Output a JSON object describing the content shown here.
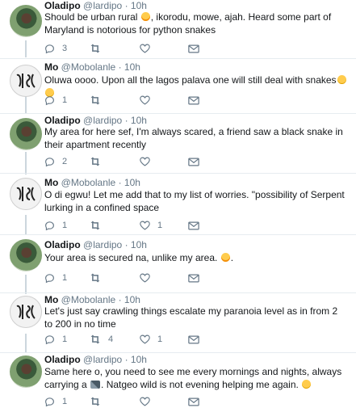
{
  "tweets": [
    {
      "author": "Oladipo",
      "handle": "@lardipo",
      "time": "10h",
      "avatar": "oladipo",
      "text_before": "Should be urban rural ",
      "emoji": "laugh",
      "text_after": ", ikorodu, mowe, ajah. Heard some part of Maryland is notorious for python snakes",
      "reply_count": "3",
      "retweet_count": "",
      "like_count": ""
    },
    {
      "author": "Mo",
      "handle": "@Mobolanle",
      "time": "10h",
      "avatar": "mo",
      "text_before": "Oluwa oooo. Upon all the lagos palava one will still deal with snakes",
      "emoji": "shock",
      "text_after": "",
      "reply_count": "1",
      "retweet_count": "",
      "like_count": ""
    },
    {
      "author": "Oladipo",
      "handle": "@lardipo",
      "time": "10h",
      "avatar": "oladipo",
      "text_before": "My area for here sef, I'm always scared, a friend saw a black snake in their apartment recently",
      "emoji": "",
      "text_after": "",
      "reply_count": "2",
      "retweet_count": "",
      "like_count": ""
    },
    {
      "author": "Mo",
      "handle": "@Mobolanle",
      "time": "10h",
      "avatar": "mo",
      "text_before": "O di egwu! Let me add that to my list of worries. \"possibility of Serpent lurking in a confined space",
      "emoji": "",
      "text_after": "",
      "reply_count": "1",
      "retweet_count": "",
      "like_count": "1"
    },
    {
      "author": "Oladipo",
      "handle": "@lardipo",
      "time": "10h",
      "avatar": "oladipo",
      "text_before": "Your area is secured na, unlike my area. ",
      "emoji": "laugh",
      "text_after": ".",
      "reply_count": "1",
      "retweet_count": "",
      "like_count": ""
    },
    {
      "author": "Mo",
      "handle": "@Mobolanle",
      "time": "10h",
      "avatar": "mo",
      "text_before": "Let's just say crawling things escalate my paranoia level as in from 2 to 200 in no time",
      "emoji": "",
      "text_after": "",
      "reply_count": "1",
      "retweet_count": "4",
      "like_count": "1"
    },
    {
      "author": "Oladipo",
      "handle": "@lardipo",
      "time": "10h",
      "avatar": "oladipo",
      "text_before": "Same here o, you need to see me every mornings and nights, always carrying a ",
      "emoji": "tool",
      "text_after": ". Natgeo wild is not evening helping me again. ",
      "emoji2": "smile",
      "reply_count": "1",
      "retweet_count": "",
      "like_count": ""
    }
  ],
  "separator": "·"
}
